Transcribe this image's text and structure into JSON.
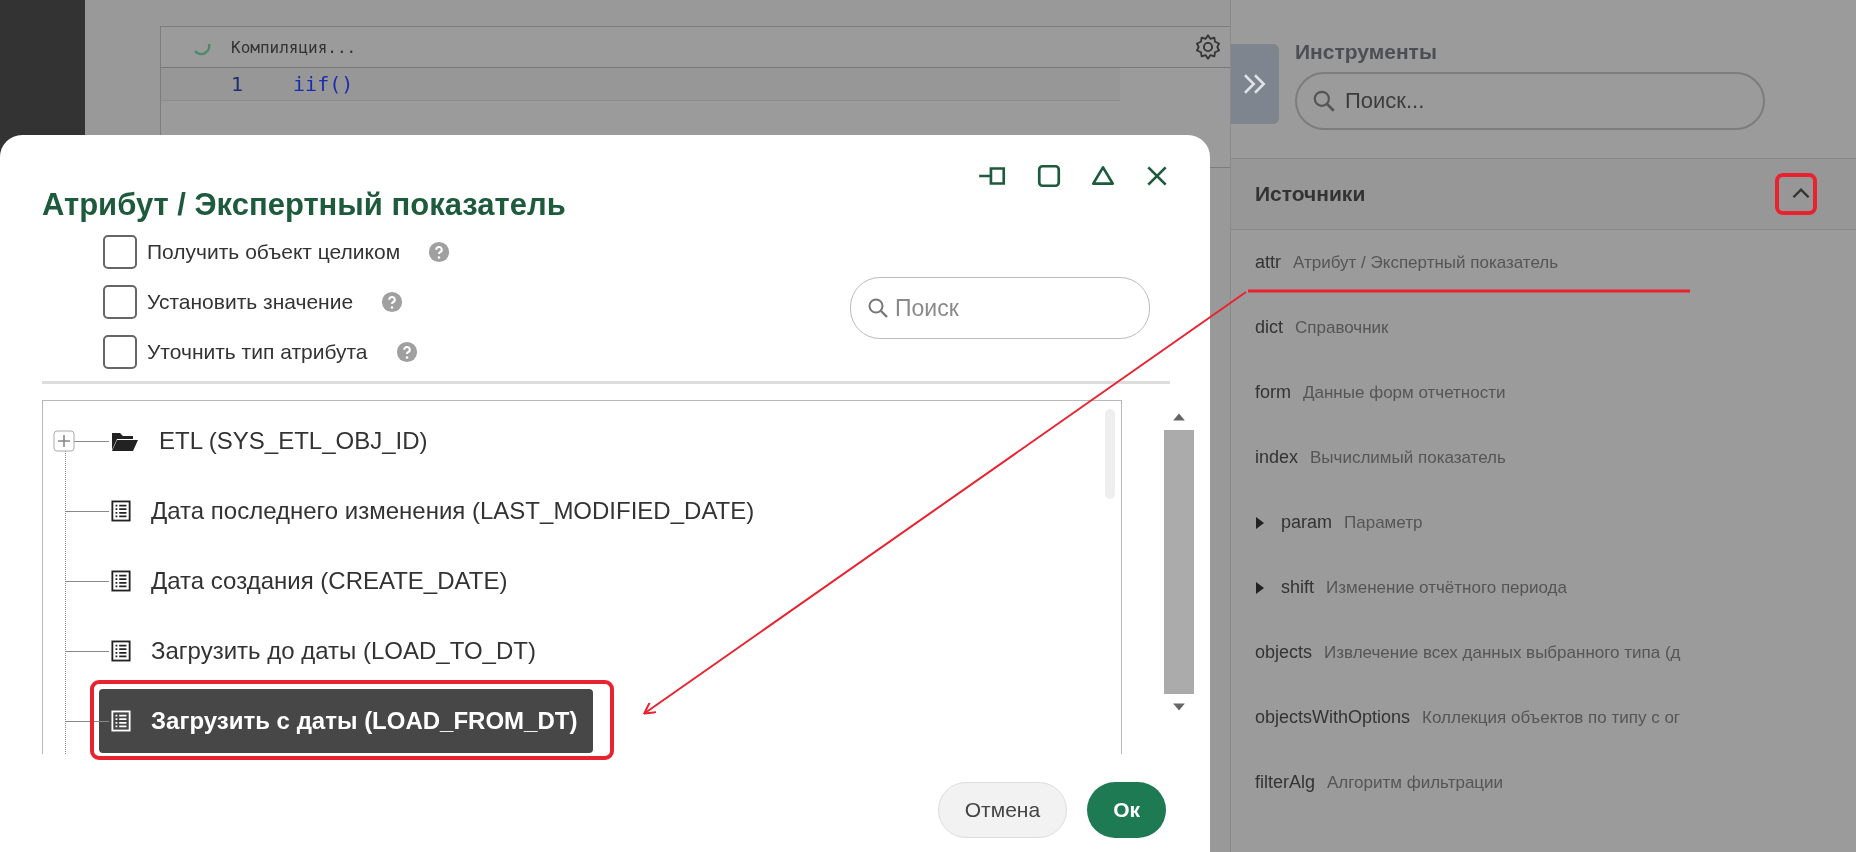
{
  "editor": {
    "status": "Компиляция...",
    "lines": [
      {
        "number": "1",
        "code": "iif()"
      }
    ]
  },
  "tools_panel": {
    "title": "Инструменты",
    "search": {
      "placeholder": "Поиск..."
    },
    "section": {
      "title": "Источники",
      "expanded": true
    },
    "items": [
      {
        "kind": "plain",
        "code": "attr",
        "description": "Атрибут / Экспертный показатель"
      },
      {
        "kind": "plain",
        "code": "dict",
        "description": "Справочник"
      },
      {
        "kind": "plain",
        "code": "form",
        "description": "Данные форм отчетности"
      },
      {
        "kind": "plain",
        "code": "index",
        "description": "Вычислимый показатель"
      },
      {
        "kind": "group",
        "code": "param",
        "description": "Параметр"
      },
      {
        "kind": "group",
        "code": "shift",
        "description": "Изменение отчётного периода"
      },
      {
        "kind": "plain",
        "code": "objects",
        "description": "Извлечение всех данных выбранного типа (д"
      },
      {
        "kind": "plain",
        "code": "objectsWithOptions",
        "description": "Коллекция объектов по типу с ог"
      },
      {
        "kind": "plain",
        "code": "filterAlg",
        "description": "Алгоритм фильтрации"
      }
    ]
  },
  "dialog": {
    "title": "Атрибут / Экспертный показатель",
    "options": [
      {
        "label": "Получить объект целиком",
        "checked": false
      },
      {
        "label": "Установить значение",
        "checked": false
      },
      {
        "label": "Уточнить тип атрибута",
        "checked": false
      }
    ],
    "search": {
      "placeholder": "Поиск"
    },
    "tree": [
      {
        "kind": "folder",
        "label": "ETL (SYS_ETL_OBJ_ID)",
        "selected": false
      },
      {
        "kind": "field",
        "label": "Дата последнего изменения (LAST_MODIFIED_DATE)",
        "selected": false
      },
      {
        "kind": "field",
        "label": "Дата создания (CREATE_DATE)",
        "selected": false
      },
      {
        "kind": "field",
        "label": "Загрузить до даты (LOAD_TO_DT)",
        "selected": false
      },
      {
        "kind": "field",
        "label": "Загрузить с даты (LOAD_FROM_DT)",
        "selected": true
      }
    ],
    "buttons": [
      {
        "kind": "secondary",
        "label": "Отмена"
      },
      {
        "kind": "primary",
        "label": "Ок"
      }
    ]
  }
}
